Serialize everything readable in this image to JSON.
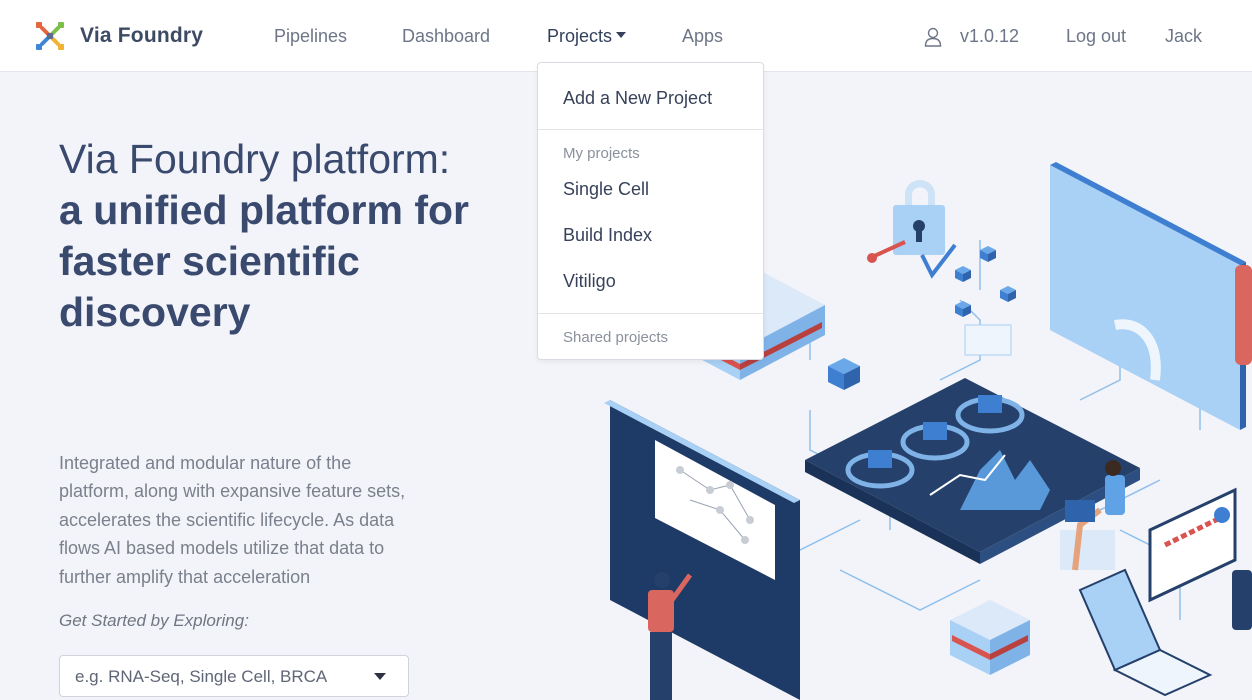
{
  "navbar": {
    "brand": "Via Foundry",
    "links": {
      "pipelines": "Pipelines",
      "dashboard": "Dashboard",
      "projects": "Projects",
      "apps": "Apps"
    },
    "version": "v1.0.12",
    "logout": "Log out",
    "user": "Jack"
  },
  "projects_menu": {
    "add": "Add a New Project",
    "my_header": "My projects",
    "my_items": [
      "Single Cell",
      "Build Index",
      "Vitiligo"
    ],
    "shared_header": "Shared projects"
  },
  "hero": {
    "title_light": "Via Foundry platform:",
    "title_bold": "a unified platform for faster scientific discovery",
    "description": "Integrated and modular nature of the platform, along with expansive feature sets, accelerates the scientific lifecycle. As data flows AI based models utilize that data to further amplify that acceleration",
    "explore_label": "Get Started by Exploring:",
    "explore_placeholder": "e.g. RNA-Seq, Single Cell, BRCA"
  },
  "icons": {
    "logo": "via-foundry-logo-icon",
    "user": "user-icon",
    "caret": "caret-down-icon"
  },
  "colors": {
    "navy": "#3a4a6e",
    "accent_blue": "#3f7fd1",
    "dark_panel": "#24406b",
    "light_blue": "#a9d0f5",
    "red": "#d9534f"
  }
}
